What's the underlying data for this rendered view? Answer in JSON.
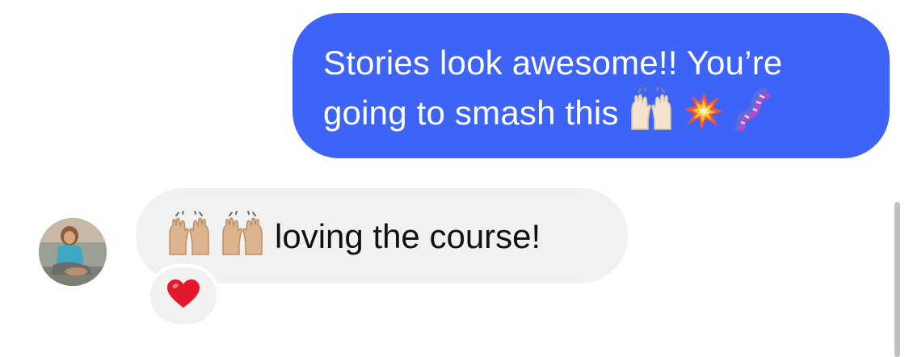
{
  "outgoing": {
    "line1": "Stories look awesome!! You’re",
    "line2": "going to smash this",
    "emojis": [
      "raising-hands-icon",
      "collision-icon",
      "dna-icon"
    ],
    "bubble_color": "#3d63f7"
  },
  "incoming": {
    "emojis": [
      "raising-hands-icon",
      "raising-hands-icon"
    ],
    "text": "loving the course!",
    "reaction": "heart-icon",
    "bubble_color": "#f1f1f2"
  }
}
